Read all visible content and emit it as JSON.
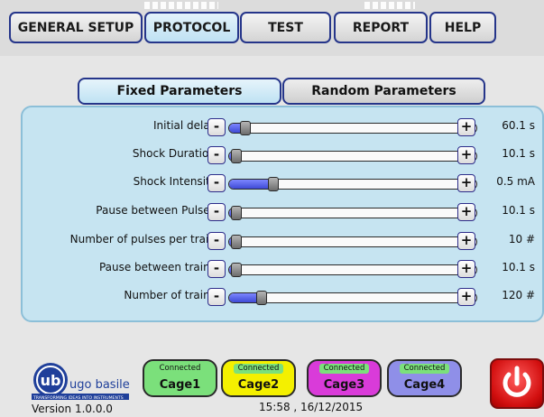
{
  "nav": {
    "tabs": [
      {
        "label": "GENERAL SETUP",
        "active": false
      },
      {
        "label": "PROTOCOL",
        "active": true
      },
      {
        "label": "TEST",
        "active": false
      },
      {
        "label": "REPORT",
        "active": false
      },
      {
        "label": "HELP",
        "active": false
      }
    ]
  },
  "protocol_tabs": [
    {
      "label": "Fixed Parameters",
      "active": true
    },
    {
      "label": "Random Parameters",
      "active": false
    }
  ],
  "parameters": [
    {
      "label": "Initial delay:",
      "value": "60.1 s",
      "slider_fraction": 0.04
    },
    {
      "label": "Shock Duration:",
      "value": "10.1 s",
      "slider_fraction": 0.0
    },
    {
      "label": "Shock Intensity:",
      "value": "0.5 mA",
      "slider_fraction": 0.16
    },
    {
      "label": "Pause between Pulses:",
      "value": "10.1 s",
      "slider_fraction": 0.0
    },
    {
      "label": "Number of pulses per train:",
      "value": "10 #",
      "slider_fraction": 0.0
    },
    {
      "label": "Pause between trains:",
      "value": "10.1 s",
      "slider_fraction": 0.0
    },
    {
      "label": "Number of trains:",
      "value": "120 #",
      "slider_fraction": 0.11
    }
  ],
  "step_buttons": {
    "minus": "-",
    "plus": "+"
  },
  "footer": {
    "logo_text": "ugo basile",
    "logo_tagline": "TRANSFORMING IDEAS INTO INSTRUMENTS",
    "version": "Version 1.0.0.0",
    "datetime": "15:58 , 16/12/2015"
  },
  "cages": [
    {
      "name": "Cage1",
      "status": "Connected",
      "color": "#7be07b"
    },
    {
      "name": "Cage2",
      "status": "Connected",
      "color": "#f4f000"
    },
    {
      "name": "Cage3",
      "status": "Connected",
      "color": "#d93bd9"
    },
    {
      "name": "Cage4",
      "status": "Connected",
      "color": "#8f8fe8"
    }
  ],
  "colors": {
    "accent": "#25358a",
    "panel": "#c6e4f1",
    "slider_fill": "#4a55e0",
    "power": "#d20f0f",
    "status_green": "#7be07b"
  },
  "icons": {
    "power": "power-icon",
    "logo": "ugo-basile-logo"
  }
}
